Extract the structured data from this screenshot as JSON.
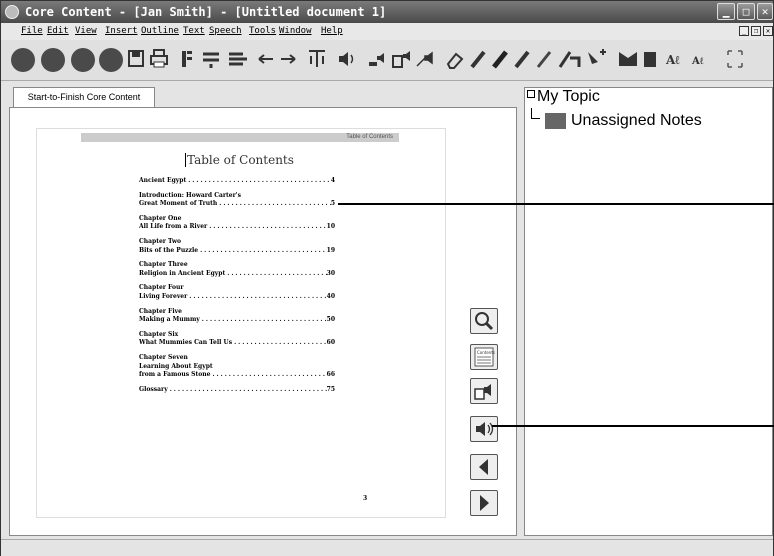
{
  "window": {
    "title": "Core Content - [Jan Smith] - [Untitled document 1]"
  },
  "menu": [
    "File",
    "Edit",
    "View",
    "Insert",
    "Outline",
    "Text",
    "Speech",
    "Tools",
    "Window",
    "Help"
  ],
  "tab": {
    "label": "Start-to-Finish Core Content"
  },
  "page": {
    "header": "Table of Contents",
    "title": "Table of Contents",
    "entries": [
      {
        "lines": [
          "Ancient Egypt"
        ],
        "page": "4"
      },
      {
        "lines": [
          "Introduction: Howard Carter's",
          "Great Moment of Truth"
        ],
        "page": "5"
      },
      {
        "lines": [
          "Chapter One",
          "All Life from a River"
        ],
        "page": "10"
      },
      {
        "lines": [
          "Chapter Two",
          "Bits of the Puzzle"
        ],
        "page": "19"
      },
      {
        "lines": [
          "Chapter Three",
          "Religion in Ancient Egypt"
        ],
        "page": "30"
      },
      {
        "lines": [
          "Chapter Four",
          "Living Forever"
        ],
        "page": "40"
      },
      {
        "lines": [
          "Chapter Five",
          "Making a Mummy"
        ],
        "page": "50"
      },
      {
        "lines": [
          "Chapter Six",
          "What Mummies Can Tell Us"
        ],
        "page": "60"
      },
      {
        "lines": [
          "Chapter Seven",
          "Learning About Egypt",
          "from a Famous Stone"
        ],
        "page": "66"
      },
      {
        "lines": [
          "Glossary"
        ],
        "page": "75"
      }
    ],
    "page_number": "3"
  },
  "nav_buttons": [
    {
      "name": "search-icon"
    },
    {
      "name": "contents-icon",
      "text": "Contents"
    },
    {
      "name": "speak-page-icon"
    },
    {
      "name": "speaker-icon"
    },
    {
      "name": "previous-page-icon"
    },
    {
      "name": "next-page-icon"
    }
  ],
  "outline": {
    "topic": "My Topic",
    "note": "Unassigned Notes"
  }
}
